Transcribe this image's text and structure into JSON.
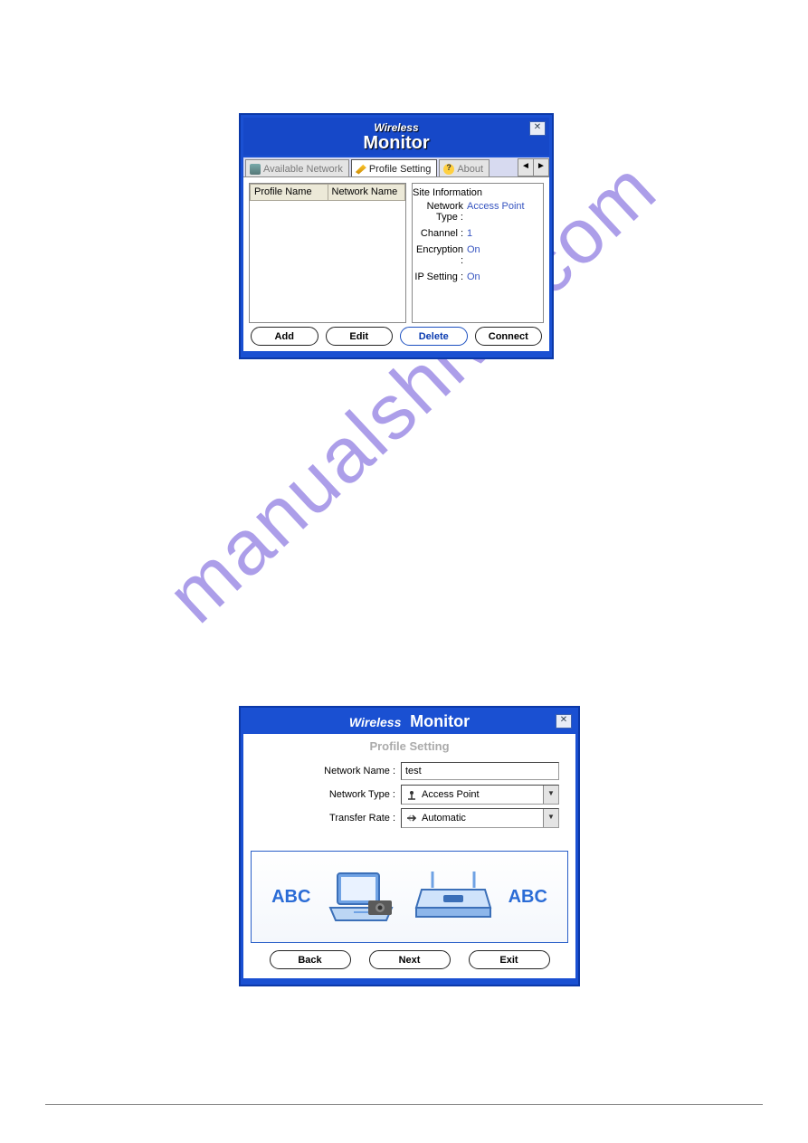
{
  "window1": {
    "title_small": "Wireless",
    "title_big": "Monitor",
    "tabs": {
      "available": "Available Network",
      "profile": "Profile Setting",
      "about": "About"
    },
    "columns": {
      "profile_name": "Profile Name",
      "network_name": "Network Name"
    },
    "site_info": {
      "legend": "Site Information",
      "network_type_label": "Network Type :",
      "network_type_value": "Access Point",
      "channel_label": "Channel :",
      "channel_value": "1",
      "encryption_label": "Encryption :",
      "encryption_value": "On",
      "ip_label": "IP Setting :",
      "ip_value": "On"
    },
    "buttons": {
      "add": "Add",
      "edit": "Edit",
      "delete": "Delete",
      "connect": "Connect"
    }
  },
  "window2": {
    "title_small": "Wireless",
    "title_big": "Monitor",
    "subtitle": "Profile Setting",
    "form": {
      "network_name_label": "Network Name :",
      "network_name_value": "test",
      "network_type_label": "Network Type :",
      "network_type_value": "Access Point",
      "transfer_rate_label": "Transfer Rate :",
      "transfer_rate_value": "Automatic"
    },
    "graphic_text": "ABC",
    "buttons": {
      "back": "Back",
      "next": "Next",
      "exit": "Exit"
    }
  },
  "watermark": "manualshive.com"
}
